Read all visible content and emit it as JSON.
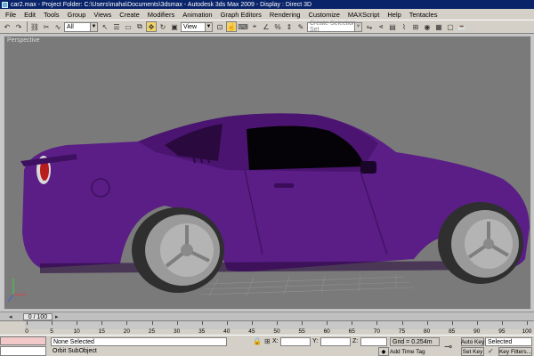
{
  "window": {
    "title": "car2.max    - Project Folder: C:\\Users\\maha\\Documents\\3dsmax    - Autodesk 3ds Max  2009      - Display : Direct 3D"
  },
  "menu": [
    "File",
    "Edit",
    "Tools",
    "Group",
    "Views",
    "Create",
    "Modifiers",
    "Animation",
    "Graph Editors",
    "Rendering",
    "Customize",
    "MAXScript",
    "Help",
    "Tentacles"
  ],
  "toolbar": {
    "filter_value": "All",
    "ref_coord_value": "View",
    "selection_set_placeholder": "Create Selection Set"
  },
  "viewport": {
    "label": "Perspective",
    "car_color": "#5a1e86",
    "wheel_color": "#9a9a9a",
    "background": "#7a7a7a"
  },
  "timeline": {
    "frame_display": "0 / 100"
  },
  "ruler": {
    "ticks": [
      "0",
      "5",
      "10",
      "15",
      "20",
      "25",
      "30",
      "35",
      "40",
      "45",
      "50",
      "55",
      "60",
      "65",
      "70",
      "75",
      "80",
      "85",
      "90",
      "95",
      "100"
    ]
  },
  "status": {
    "selection_text": "None Selected",
    "prompt_text": "Orbit SubObject",
    "x_label": "X:",
    "y_label": "Y:",
    "z_label": "Z:",
    "grid_text": "Grid = 0.254m",
    "add_time_tag": "Add Time Tag",
    "auto_key": "Auto Key",
    "set_key": "Set Key",
    "selected_value": "Selected",
    "key_filters": "Key Filters..."
  }
}
